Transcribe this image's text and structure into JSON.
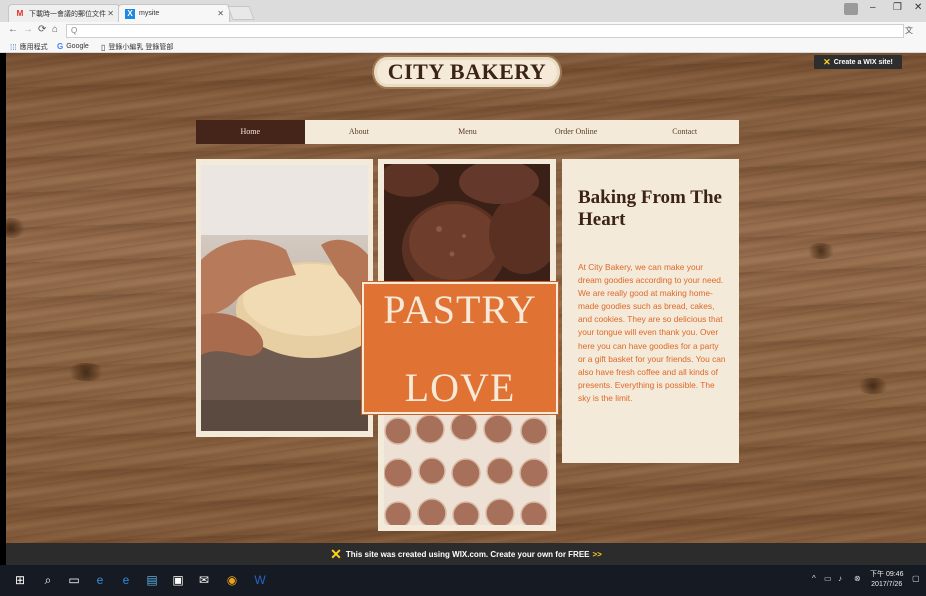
{
  "browser": {
    "tabs": [
      {
        "label": "下載時一會議的郵位文件",
        "icon": "gmail-icon"
      },
      {
        "label": "mysite",
        "icon": "wix-icon"
      }
    ],
    "url_text": "Q",
    "bookmarks": [
      {
        "label": "應用程式",
        "icon": "apps-icon"
      },
      {
        "label": "Google",
        "icon": "google-icon"
      },
      {
        "label": "登錄小編乳 登錄管部",
        "icon": "page-icon"
      }
    ]
  },
  "site": {
    "wix_create_label": "Create a WIX site!",
    "logo": "CITY BAKERY",
    "menu": [
      {
        "label": "Home",
        "active": true
      },
      {
        "label": "About",
        "active": false
      },
      {
        "label": "Menu",
        "active": false
      },
      {
        "label": "Order Online",
        "active": false
      },
      {
        "label": "Contact",
        "active": false
      }
    ],
    "promo": {
      "line1": "PASTRY",
      "line2": "LOVE"
    },
    "heading": "Baking From The Heart",
    "body": "At City Bakery, we can make your dream goodies according to your need. We are really good at making home-made goodies such as bread, cakes, and cookies. They are so delicious that your tongue will even thank you. Over here you can have goodies for a party or a gift basket for your friends. You can also have fresh coffee and all kinds of presents. Everything is possible. The sky is the limit.",
    "wix_banner": "This site was created using WIX.com. Create your own for FREE",
    "wix_banner_arrow": ">>"
  },
  "taskbar": {
    "clock_time": "下午 09:46",
    "clock_date": "2017/7/26"
  },
  "colors": {
    "accent_orange": "#e07233",
    "brand_brown": "#45241a",
    "panel_cream": "#f3ead9"
  }
}
